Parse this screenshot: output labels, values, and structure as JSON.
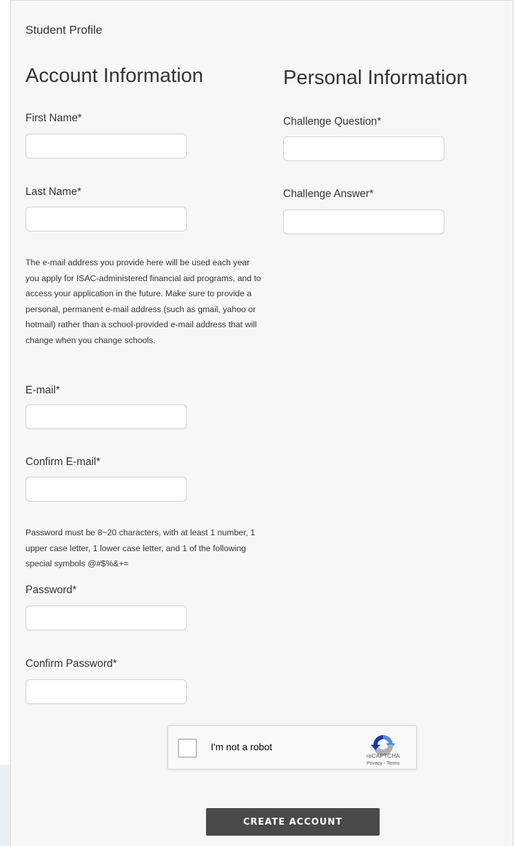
{
  "breadcrumb": "Student Profile",
  "account": {
    "heading": "Account Information",
    "first_name_label": "First Name*",
    "last_name_label": "Last Name*",
    "email_note": "The e-mail address you provide here will be used each year you apply for ISAC-administered financial aid programs, and to access your application in the future. Make sure to provide a personal, permanent e-mail address (such as gmail, yahoo or hotmail) rather than a school-provided e-mail address that will change when you change schools.",
    "email_label": "E-mail*",
    "confirm_email_label": "Confirm E-mail*",
    "password_note": "Password must be 8~20 characters, with at least 1 number, 1 upper case letter, 1 lower case letter, and 1 of the following special symbols @#$%&+=",
    "password_label": "Password*",
    "confirm_password_label": "Confirm Password*"
  },
  "personal": {
    "heading": "Personal Information",
    "challenge_question_label": "Challenge Question*",
    "challenge_answer_label": "Challenge Answer*"
  },
  "fields": {
    "first_name": "",
    "last_name": "",
    "email": "",
    "confirm_email": "",
    "password": "",
    "confirm_password": "",
    "challenge_question": "",
    "challenge_answer": ""
  },
  "captcha": {
    "label": "I'm not a robot",
    "brand": "reCAPTCHA",
    "links": "Privacy - Terms",
    "icon": "recaptcha-logo-icon"
  },
  "submit_label": "CREATE ACCOUNT",
  "colors": {
    "panel_bg": "#f7f7f7",
    "button_bg": "#4a4a4a",
    "text": "#333333"
  }
}
